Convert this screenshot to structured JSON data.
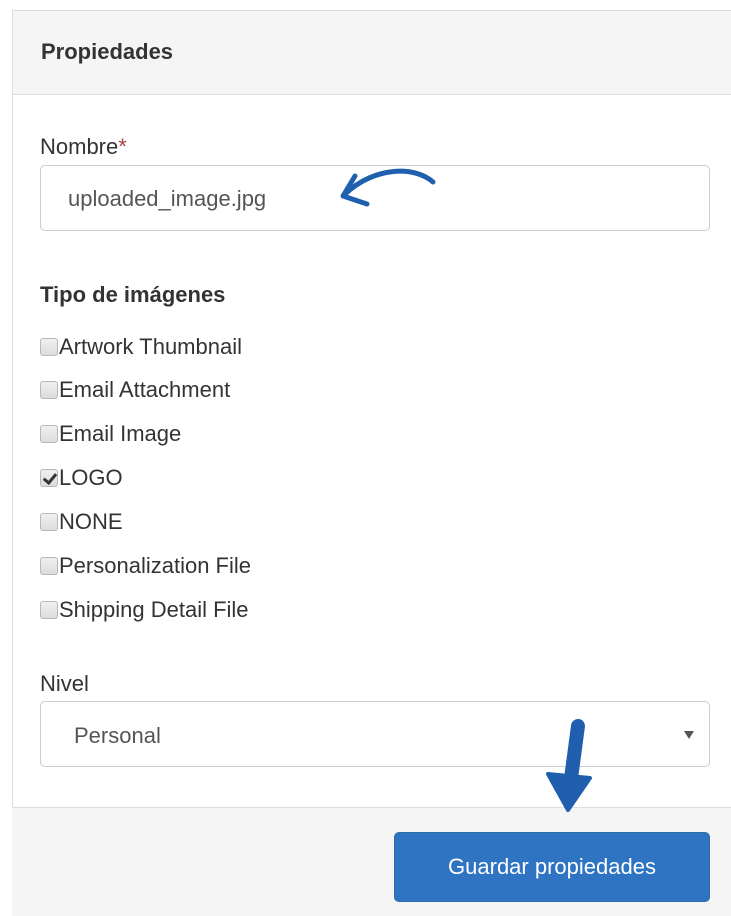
{
  "panel": {
    "title": "Propiedades"
  },
  "name_field": {
    "label": "Nombre",
    "required_marker": "*",
    "value": "uploaded_image.jpg"
  },
  "image_types": {
    "title": "Tipo de imágenes",
    "options": [
      {
        "label": "Artwork Thumbnail",
        "checked": false
      },
      {
        "label": "Email Attachment",
        "checked": false
      },
      {
        "label": "Email Image",
        "checked": false
      },
      {
        "label": "LOGO",
        "checked": true
      },
      {
        "label": "NONE",
        "checked": false
      },
      {
        "label": "Personalization File",
        "checked": false
      },
      {
        "label": "Shipping Detail File",
        "checked": false
      }
    ]
  },
  "level_field": {
    "label": "Nivel",
    "selected": "Personal"
  },
  "footer": {
    "save_label": "Guardar propiedades"
  },
  "annotation": {
    "arrow_color": "#1f5fae",
    "name_arrow_icon": "curved-arrow-left-icon",
    "save_arrow_icon": "arrow-down-icon"
  },
  "colors": {
    "primary": "#2f73c3",
    "required": "#a94442",
    "panel_bg": "#f5f5f5"
  }
}
